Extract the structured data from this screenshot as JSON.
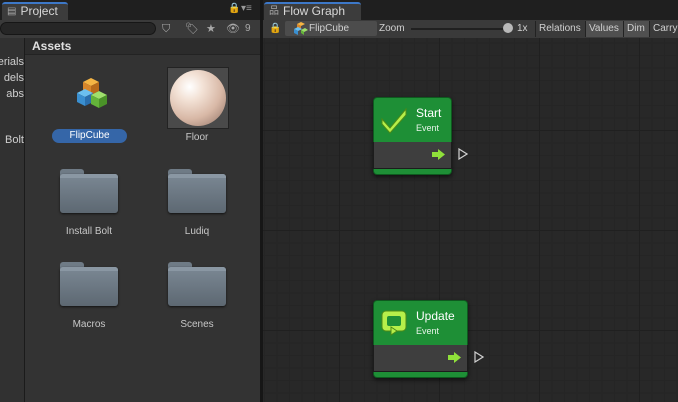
{
  "project_panel": {
    "tab_label": "Project",
    "visible_count": "9",
    "sidebar_items": [
      "erials",
      "dels",
      "abs",
      "Bolt"
    ],
    "assets_header": "Assets",
    "assets": [
      {
        "label": "FlipCube",
        "type": "prefab",
        "selected": true
      },
      {
        "label": "Floor",
        "type": "material",
        "selected": false
      },
      {
        "label": "Install Bolt",
        "type": "folder",
        "selected": false
      },
      {
        "label": "Ludiq",
        "type": "folder",
        "selected": false
      },
      {
        "label": "Macros",
        "type": "folder",
        "selected": false
      },
      {
        "label": "Scenes",
        "type": "folder",
        "selected": false
      }
    ]
  },
  "graph_panel": {
    "tab_label": "Flow Graph",
    "breadcrumb": "FlipCube",
    "zoom_label": "Zoom",
    "zoom_value": "1x",
    "zoom_level": 1.0,
    "buttons": [
      "Relations",
      "Values",
      "Dim",
      "Carry"
    ],
    "nodes": [
      {
        "title": "Start",
        "subtitle": "Event",
        "icon": "check-icon"
      },
      {
        "title": "Update",
        "subtitle": "Event",
        "icon": "loop-icon"
      }
    ]
  },
  "colors": {
    "node_green": "#1e8f36",
    "selection_blue": "#3566a8",
    "tab_accent": "#3d78c8",
    "flow_arrow": "#8fe03a"
  }
}
